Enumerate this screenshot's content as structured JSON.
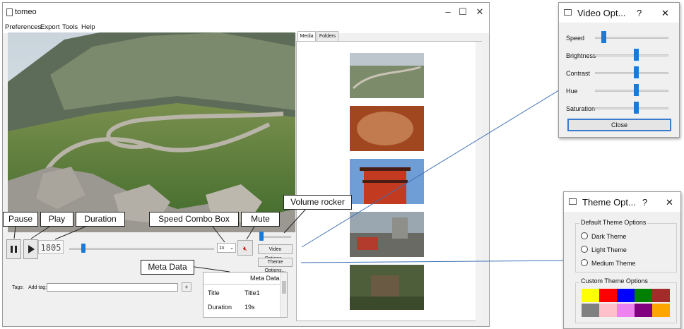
{
  "window": {
    "title": "tomeo",
    "minimize": "–",
    "maximize": "☐",
    "close": "✕"
  },
  "menu": [
    "Preferences",
    "Export",
    "Tools",
    "Help"
  ],
  "player": {
    "duration": "1805",
    "speed": "1x",
    "video_options": "Video Options...",
    "theme_options": "Theme Options..."
  },
  "tags": {
    "label": "Tags:",
    "add_tag": "Add tag:",
    "add_button": "+"
  },
  "metadata": {
    "header": "Meta Data",
    "rows": [
      [
        "Title",
        "Title1"
      ],
      [
        "Duration",
        "19s"
      ]
    ]
  },
  "media_panel": {
    "tabs": [
      "Media",
      "Folders"
    ]
  },
  "callouts": {
    "pause": "Pause",
    "play": "Play",
    "duration": "Duration",
    "speed_combo": "Speed Combo Box",
    "mute": "Mute",
    "volume": "Volume rocker",
    "meta": "Meta Data"
  },
  "video_dialog": {
    "title": "Video Opt...",
    "help": "?",
    "close_x": "✕",
    "sliders": [
      {
        "label": "Speed",
        "level": 0.02
      },
      {
        "label": "Brightness",
        "level": 0.48
      },
      {
        "label": "Contrast",
        "level": 0.48
      },
      {
        "label": "Hue",
        "level": 0.48
      },
      {
        "label": "Saturation",
        "level": 0.48
      }
    ],
    "close_button": "Close"
  },
  "theme_dialog": {
    "title": "Theme Opt...",
    "help": "?",
    "close_x": "✕",
    "default_group": "Default Theme Options",
    "options": [
      "Dark Theme",
      "Light Theme",
      "Medium Theme"
    ],
    "custom_group": "Custom Theme Options",
    "swatches": [
      "#ffff00",
      "#ff0000",
      "#0000ff",
      "#008000",
      "#a52a2a",
      "#808080",
      "#ffc0cb",
      "#ee82ee",
      "#800080",
      "#ffa500"
    ]
  }
}
